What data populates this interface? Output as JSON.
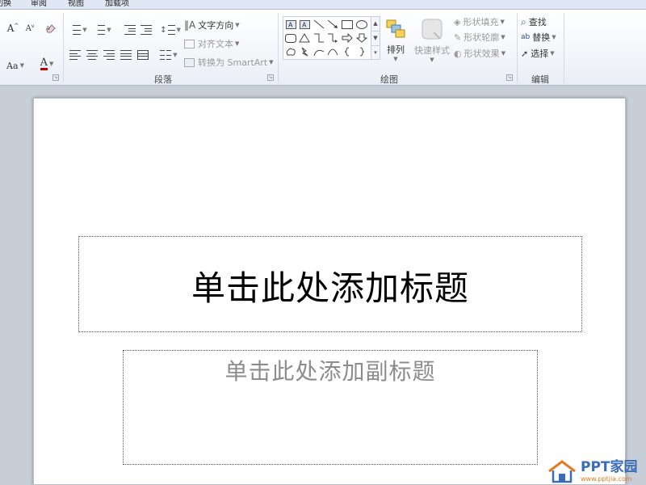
{
  "tabs": [
    {
      "label": "切换"
    },
    {
      "label": "审阅"
    },
    {
      "label": "视图"
    },
    {
      "label": "加载项"
    }
  ],
  "ribbon": {
    "font": {
      "grow_label": "A",
      "shrink_label": "A",
      "case_label": "Aa",
      "color_label": "A"
    },
    "paragraph": {
      "group_label": "段落",
      "text_direction": "文字方向",
      "align_text": "对齐文本",
      "convert_smartart": "转换为 SmartArt"
    },
    "drawing": {
      "group_label": "绘图",
      "arrange": "排列",
      "quick_styles": "快速样式",
      "shape_fill": "形状填充",
      "shape_outline": "形状轮廓",
      "shape_effects": "形状效果"
    },
    "editing": {
      "group_label": "编辑",
      "find": "查找",
      "replace": "替换",
      "select": "选择"
    }
  },
  "slide": {
    "title_placeholder": "单击此处添加标题",
    "subtitle_placeholder": "单击此处添加副标题"
  },
  "watermark": {
    "brand": "PPT家园",
    "url": "www.pptjia.com"
  },
  "colors": {
    "accent_blue": "#3a6db8",
    "accent_orange": "#e07b1f",
    "ribbon_border": "#aebfd5"
  }
}
